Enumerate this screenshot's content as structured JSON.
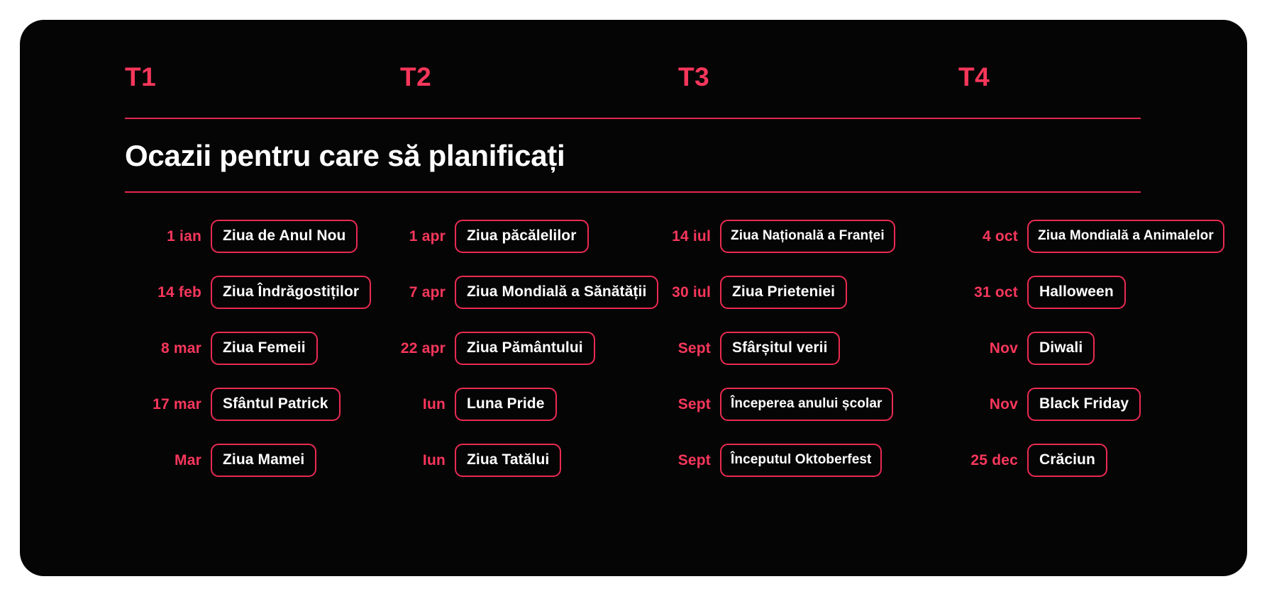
{
  "colors": {
    "card_background": "#050506",
    "page_background": "#ffffff",
    "accent": "#f8375b",
    "rule": "#e5264d",
    "pill_border": "#ea2a50",
    "pill_text": "#ffffff"
  },
  "header": {
    "quarters": [
      "T1",
      "T2",
      "T3",
      "T4"
    ]
  },
  "title": "Ocazii pentru care să planificați",
  "columns": [
    {
      "quarter": "T1",
      "rows": [
        {
          "date": "1 ian",
          "occasion": "Ziua de Anul Nou"
        },
        {
          "date": "14 feb",
          "occasion": "Ziua Îndrăgostiților"
        },
        {
          "date": "8 mar",
          "occasion": "Ziua Femeii"
        },
        {
          "date": "17 mar",
          "occasion": "Sfântul Patrick"
        },
        {
          "date": "Mar",
          "occasion": "Ziua Mamei"
        }
      ]
    },
    {
      "quarter": "T2",
      "rows": [
        {
          "date": "1 apr",
          "occasion": "Ziua păcălelilor"
        },
        {
          "date": "7 apr",
          "occasion": "Ziua Mondială a Sănătății"
        },
        {
          "date": "22 apr",
          "occasion": "Ziua Pământului"
        },
        {
          "date": "Iun",
          "occasion": "Luna Pride"
        },
        {
          "date": "Iun",
          "occasion": "Ziua Tatălui"
        }
      ]
    },
    {
      "quarter": "T3",
      "rows": [
        {
          "date": "14 iul",
          "occasion": "Ziua Națională a Franței"
        },
        {
          "date": "30 iul",
          "occasion": "Ziua Prieteniei"
        },
        {
          "date": "Sept",
          "occasion": "Sfârșitul verii"
        },
        {
          "date": "Sept",
          "occasion": "Începerea anului școlar"
        },
        {
          "date": "Sept",
          "occasion": "Începutul Oktoberfest"
        }
      ]
    },
    {
      "quarter": "T4",
      "rows": [
        {
          "date": "4 oct",
          "occasion": "Ziua Mondială a Animalelor"
        },
        {
          "date": "31 oct",
          "occasion": "Halloween"
        },
        {
          "date": "Nov",
          "occasion": "Diwali"
        },
        {
          "date": "Nov",
          "occasion": "Black Friday"
        },
        {
          "date": "25 dec",
          "occasion": "Crăciun"
        }
      ]
    }
  ]
}
